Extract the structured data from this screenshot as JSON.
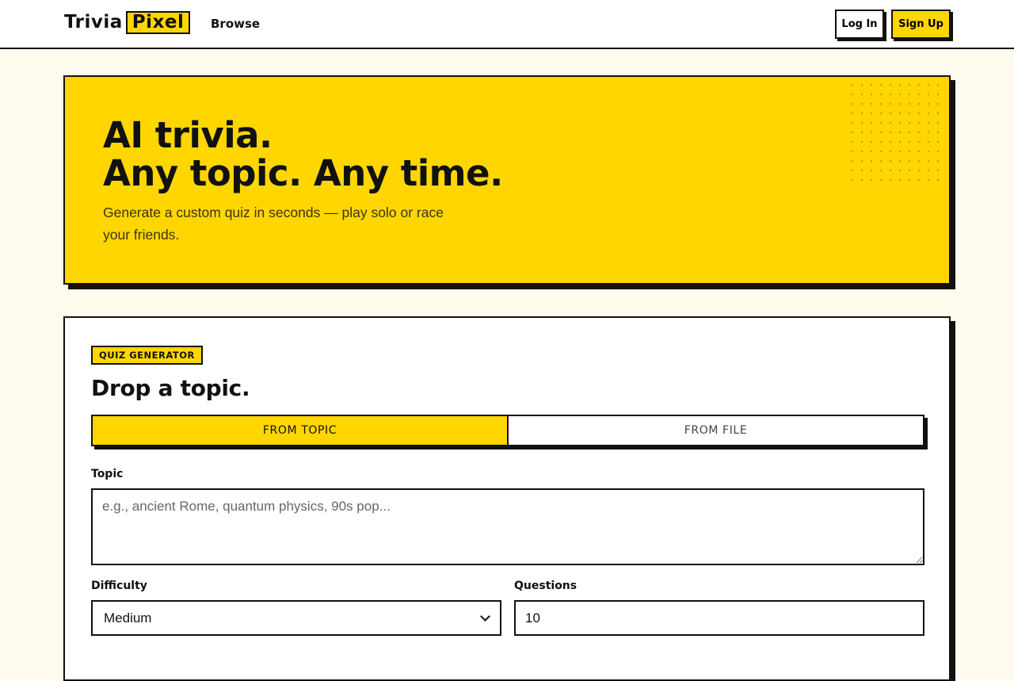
{
  "header": {
    "brand_part1": "Trivia",
    "brand_part2": "Pixel",
    "nav_browse": "Browse",
    "login_label": "Log In",
    "signup_label": "Sign Up"
  },
  "hero": {
    "title_line1": "AI trivia.",
    "title_line2": "Any topic. Any time.",
    "subtitle": "Generate a custom quiz in seconds — play solo or race your friends."
  },
  "generator": {
    "badge": "QUIZ GENERATOR",
    "title": "Drop a topic.",
    "tabs": [
      {
        "label": "FROM TOPIC",
        "active": true
      },
      {
        "label": "FROM FILE",
        "active": false
      }
    ],
    "topic_label": "Topic",
    "topic_placeholder": "e.g., ancient Rome, quantum physics, 90s pop...",
    "difficulty_label": "Difficulty",
    "difficulty_value": "Medium",
    "questions_label": "Questions",
    "questions_value": "10"
  },
  "colors": {
    "accent": "#ffd600",
    "ink": "#111111",
    "page_bg": "#fffcef"
  }
}
